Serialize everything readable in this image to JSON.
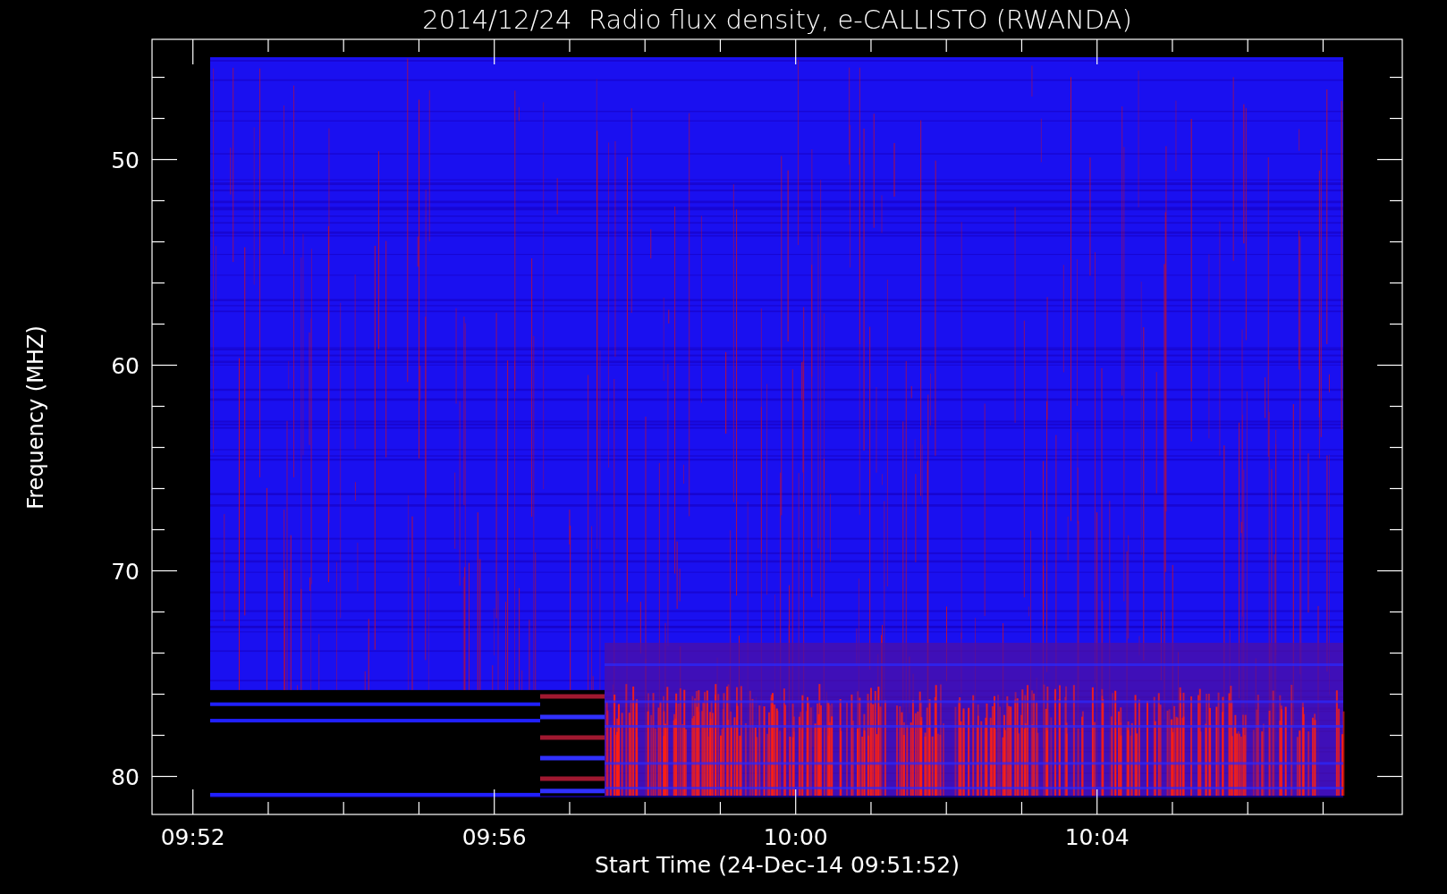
{
  "title": "2014/12/24  Radio flux density, e-CALLISTO (RWANDA)",
  "plot": {
    "y_axis": {
      "label": "Frequency (MHZ)",
      "ticks": [
        "50",
        "60",
        "70",
        "80"
      ]
    },
    "x_axis": {
      "label": "Start Time (24-Dec-14 09:51:52)",
      "ticks": [
        "09:52",
        "09:56",
        "10:00",
        "10:04"
      ]
    }
  }
}
